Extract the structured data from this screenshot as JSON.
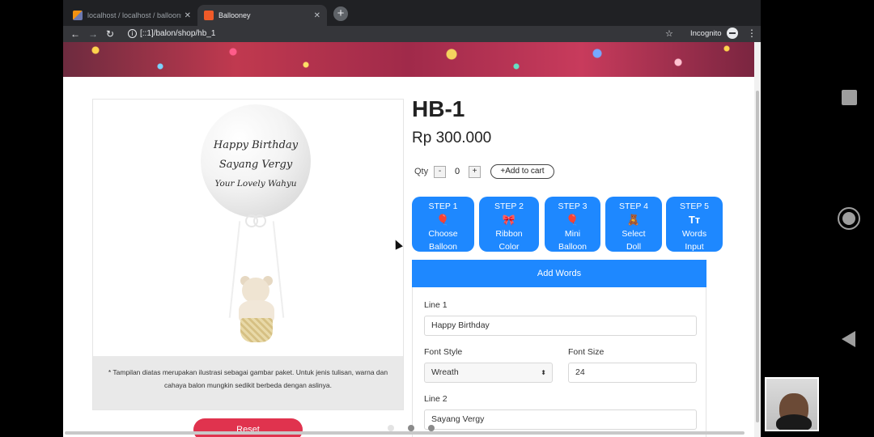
{
  "browser": {
    "tabs": [
      {
        "title": "localhost / localhost / balloons",
        "active": false
      },
      {
        "title": "Ballooney",
        "active": true
      }
    ],
    "new_tab_label": "+",
    "url": "[::1]/balon/shop/hb_1",
    "incognito_label": "Incognito"
  },
  "product": {
    "image": {
      "line1": "Happy Birthday",
      "line2": "Sayang Vergy",
      "line3": "Your Lovely Wahyu"
    },
    "disclaimer": "* Tampilan diatas merupakan ilustrasi sebagai gambar paket. Untuk jenis tulisan, warna dan cahaya balon mungkin sedikit berbeda dengan aslinya.",
    "reset_label": "Reset",
    "title": "HB-1",
    "price": "Rp 300.000",
    "qty_label": "Qty",
    "qty_minus": "-",
    "qty_value": "0",
    "qty_plus": "+",
    "add_to_cart": "+Add to cart"
  },
  "steps": [
    {
      "step": "STEP 1",
      "icon": "balloon-icon",
      "glyph": "🎈",
      "line1": "Choose",
      "line2": "Balloon"
    },
    {
      "step": "STEP 2",
      "icon": "ribbon-icon",
      "glyph": "🎀",
      "line1": "Ribbon",
      "line2": "Color"
    },
    {
      "step": "STEP 3",
      "icon": "mini-balloons-icon",
      "glyph": "🎈",
      "line1": "Mini",
      "line2": "Balloon"
    },
    {
      "step": "STEP 4",
      "icon": "doll-icon",
      "glyph": "🧸",
      "line1": "Select",
      "line2": "Doll"
    },
    {
      "step": "STEP 5",
      "icon": "text-size-icon",
      "glyph": "Tт",
      "line1": "Words",
      "line2": "Input"
    }
  ],
  "add_words": {
    "header": "Add Words",
    "line1_label": "Line 1",
    "line1_value": "Happy Birthday",
    "font_style_label": "Font Style",
    "font_style_value": "Wreath",
    "font_size_label": "Font Size",
    "font_size_value": "24",
    "line2_label": "Line 2",
    "line2_value": "Sayang Vergy"
  },
  "colors": {
    "primary_blue": "#1e88ff",
    "reset_red": "#e0334e",
    "browser_dark": "#202124"
  }
}
